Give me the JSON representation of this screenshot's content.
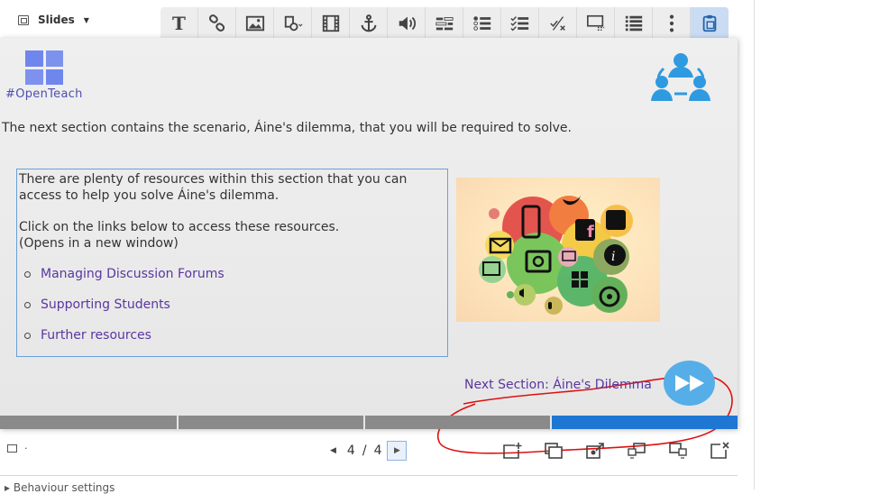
{
  "top": {
    "slides_label": "Slides"
  },
  "toolbar": {
    "buttons": [
      {
        "icon": "text-icon",
        "glyph": "T"
      },
      {
        "icon": "link-icon"
      },
      {
        "icon": "image-icon"
      },
      {
        "icon": "shapes-icon"
      },
      {
        "icon": "video-icon"
      },
      {
        "icon": "anchor-icon"
      },
      {
        "icon": "audio-icon"
      },
      {
        "icon": "fill-in-blanks-icon"
      },
      {
        "icon": "single-choice-icon"
      },
      {
        "icon": "multi-choice-icon"
      },
      {
        "icon": "true-false-icon"
      },
      {
        "icon": "drag-text-icon"
      },
      {
        "icon": "summary-icon"
      },
      {
        "icon": "more-icon"
      },
      {
        "icon": "paste-icon",
        "active": true
      }
    ]
  },
  "slide": {
    "logo_text": "#OpenTeach",
    "intro": "The next section contains the scenario, Áine's dilemma, that you will be required to solve.",
    "box": {
      "p1": "There are plenty of resources within this section that you can access to help you solve Áine's dilemma.",
      "p2a": "Click on the links below to access these resources.",
      "p2b": "(Opens in a new window)",
      "links": [
        "Managing Discussion Forums",
        "Supporting Students",
        "Further resources"
      ]
    },
    "image_alt": "social media icons",
    "next_link": "Next Section: Áine's Dilemma",
    "progress": {
      "total": 4,
      "current": 4
    }
  },
  "pager": {
    "current": "4",
    "separator": "/",
    "total": "4"
  },
  "behaviour": "Behaviour settings",
  "colors": {
    "accent": "#1f77d4",
    "link": "#5a36a0",
    "button": "#56aee8",
    "logo": "#7d92ee",
    "annotation": "#e01010"
  }
}
